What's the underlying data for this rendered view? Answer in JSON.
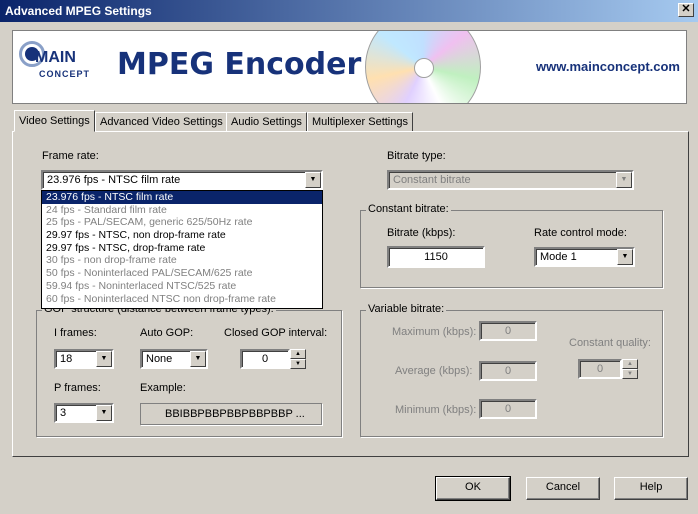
{
  "window": {
    "title": "Advanced MPEG Settings",
    "close_glyph": "✕"
  },
  "banner": {
    "logo_main": "MAIN",
    "logo_concept": "CONCEPT",
    "title": "MPEG Encoder",
    "url": "www.mainconcept.com"
  },
  "tabs": [
    {
      "label": "Video Settings",
      "active": true
    },
    {
      "label": "Advanced Video Settings",
      "active": false
    },
    {
      "label": "Audio Settings",
      "active": false
    },
    {
      "label": "Multiplexer Settings",
      "active": false
    }
  ],
  "frame_rate": {
    "label": "Frame rate:",
    "value": "23.976 fps - NTSC film rate",
    "options": [
      {
        "text": "23.976 fps - NTSC film rate",
        "state": "selected"
      },
      {
        "text": "24 fps - Standard film rate",
        "state": "disabled"
      },
      {
        "text": "25 fps - PAL/SECAM, generic 625/50Hz rate",
        "state": "disabled"
      },
      {
        "text": "29.97 fps - NTSC, non drop-frame rate",
        "state": "enabled"
      },
      {
        "text": "29.97 fps - NTSC, drop-frame rate",
        "state": "enabled"
      },
      {
        "text": "30 fps - non drop-frame rate",
        "state": "disabled"
      },
      {
        "text": "50 fps - Noninterlaced PAL/SECAM/625 rate",
        "state": "disabled"
      },
      {
        "text": "59.94 fps - Noninterlaced NTSC/525 rate",
        "state": "disabled"
      },
      {
        "text": "60 fps - Noninterlaced NTSC non drop-frame rate",
        "state": "disabled"
      }
    ]
  },
  "bitrate_type": {
    "label": "Bitrate type:",
    "value": "Constant bitrate"
  },
  "constant_bitrate": {
    "group_label": "Constant bitrate:",
    "bitrate_label": "Bitrate (kbps):",
    "bitrate_value": "1150",
    "rate_control_label": "Rate control mode:",
    "rate_control_value": "Mode 1"
  },
  "gop": {
    "group_label": "GOP structure (distance between frame types):",
    "i_frames_label": "I frames:",
    "i_frames_value": "18",
    "auto_gop_label": "Auto GOP:",
    "auto_gop_value": "None",
    "closed_gop_label": "Closed GOP interval:",
    "closed_gop_value": "0",
    "p_frames_label": "P frames:",
    "p_frames_value": "3",
    "example_label": "Example:",
    "example_value": "BBIBBPBBPBBPBBPBBP ..."
  },
  "variable_bitrate": {
    "group_label": "Variable bitrate:",
    "maximum_label": "Maximum (kbps):",
    "maximum_value": "0",
    "average_label": "Average (kbps):",
    "average_value": "0",
    "minimum_label": "Minimum (kbps):",
    "minimum_value": "0",
    "constant_quality_label": "Constant quality:",
    "constant_quality_value": "0"
  },
  "buttons": {
    "ok": "OK",
    "cancel": "Cancel",
    "help": "Help"
  },
  "glyphs": {
    "arrow_down": "▼",
    "arrow_up": "▲"
  },
  "colors": {
    "title_bar": "#0a246a",
    "selection": "#0a246a",
    "brand": "#17327a",
    "face": "#d4d0c8"
  }
}
